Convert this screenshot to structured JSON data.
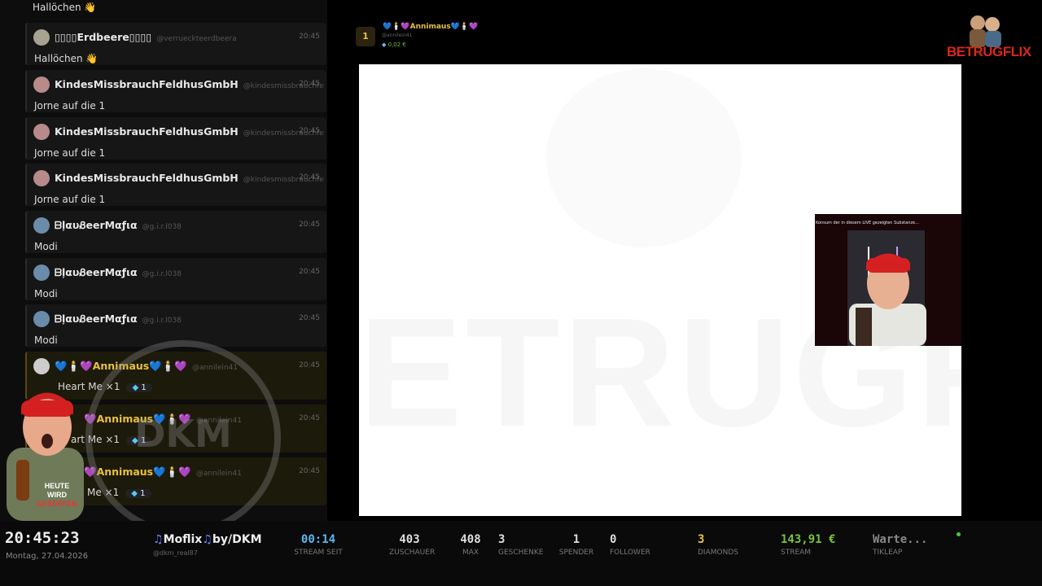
{
  "chat": {
    "first_partial": "Hallöchen 👋",
    "messages": [
      {
        "name": "▯▯▯▯Erdbeere▯▯▯▯",
        "handle": "@verrueckteerdbeera",
        "time": "20:45",
        "text": "Hallöchen 👋",
        "avatar": "#a8a290"
      },
      {
        "name": "KindesMissbrauchFeldhusGmbH",
        "handle": "@kindesmissbrauchfe",
        "time": "20:45",
        "text": "Jorne auf die 1",
        "avatar": "#b88a8a"
      },
      {
        "name": "KindesMissbrauchFeldhusGmbH",
        "handle": "@kindesmissbrauchfe",
        "time": "20:45",
        "text": "Jorne auf die 1",
        "avatar": "#b88a8a"
      },
      {
        "name": "KindesMissbrauchFeldhusGmbH",
        "handle": "@kindesmissbrauchfe",
        "time": "20:45",
        "text": "Jorne auf die 1",
        "avatar": "#b88a8a"
      },
      {
        "name": "ᗷļαυᏰeerMαƒια",
        "handle": "@g.i.r.l038",
        "time": "20:45",
        "text": "Modi",
        "avatar": "#6a8caa"
      },
      {
        "name": "ᗷļαυᏰeerMαƒια",
        "handle": "@g.i.r.l038",
        "time": "20:45",
        "text": "Modi",
        "avatar": "#6a8caa"
      },
      {
        "name": "ᗷļαυᏰeerMαƒια",
        "handle": "@g.i.r.l038",
        "time": "20:45",
        "text": "Modi",
        "avatar": "#6a8caa"
      }
    ],
    "gifts": [
      {
        "name": "💙🕯️💜Annimaus💙🕯️💜",
        "handle": "@annilein41",
        "time": "20:45",
        "text": "Heart Me ×1",
        "count": "1"
      },
      {
        "name": "💜Annimaus💙🕯️💜",
        "handle": "@annilein41",
        "time": "20:45",
        "text": "art Me ×1",
        "count": "1"
      },
      {
        "name": "💜Annimaus💙🕯️💜",
        "handle": "@annilein41",
        "time": "20:45",
        "text": "Me ×1",
        "count": "1"
      }
    ]
  },
  "overlay_logo_text": "DKM",
  "top_gifter": {
    "rank": "1",
    "name": "💙🕯️💜Annimaus💙🕯️💜",
    "handle": "@annilein41",
    "value": "0,02 €"
  },
  "pip_caption": "Konsum der in diesem LIVE gezeigten Substanze...",
  "video_watermark": "ETRUGFLIX",
  "brand": "BETRUGFLIX",
  "bottom": {
    "clock": "20:45:23",
    "date": "Montag, 27.04.2026",
    "channel_name": "Moflix",
    "channel_by": "by/DKM",
    "channel_handle": "@dkm_real87",
    "stats": [
      {
        "value": "00:14",
        "label": "STREAM SEIT",
        "color": "#5bb8f0"
      },
      {
        "value": "403",
        "label": "ZUSCHAUER",
        "color": "#dddddd"
      },
      {
        "value": "408",
        "label": "MAX",
        "color": "#dddddd"
      },
      {
        "value": "3",
        "label": "GESCHENKE",
        "color": "#dddddd"
      },
      {
        "value": "1",
        "label": "SPENDER",
        "color": "#dddddd"
      },
      {
        "value": "0",
        "label": "FOLLOWER",
        "color": "#dddddd"
      },
      {
        "value": "3",
        "label": "DIAMONDS",
        "color": "#e8c040"
      },
      {
        "value": "143,91 €",
        "label": "STREAM",
        "color": "#7ac13a"
      },
      {
        "value": "Warte...",
        "label": "TIKLEAP",
        "color": "#888888"
      }
    ]
  }
}
